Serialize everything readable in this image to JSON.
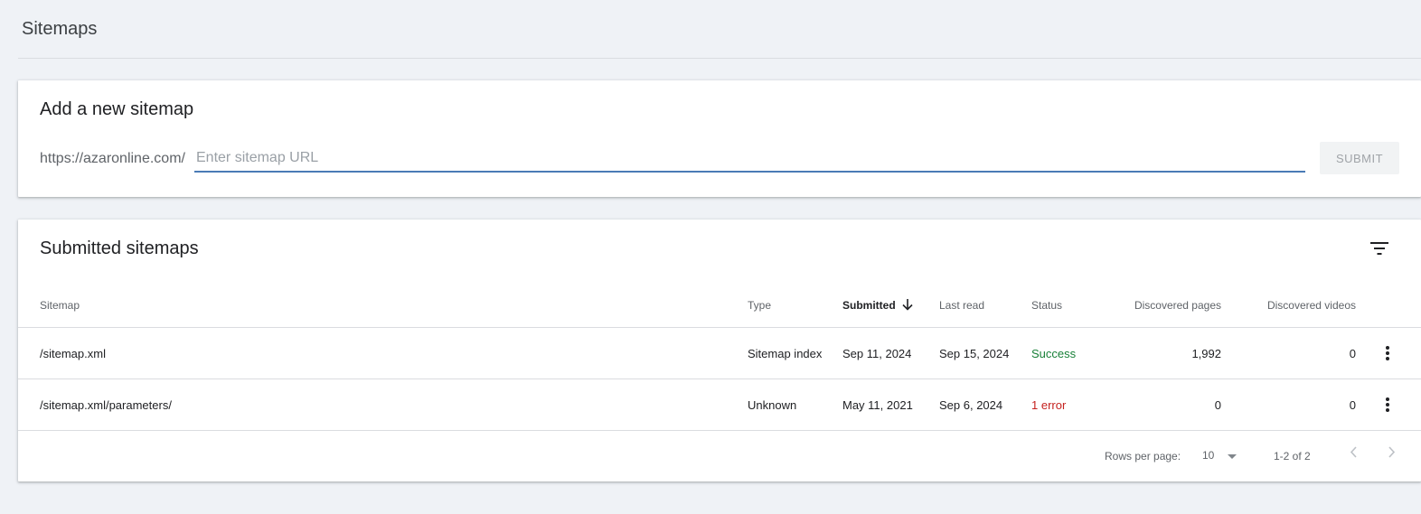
{
  "page": {
    "title": "Sitemaps"
  },
  "add_sitemap": {
    "title": "Add a new sitemap",
    "url_prefix": "https://azaronline.com/",
    "input_value": "",
    "input_placeholder": "Enter sitemap URL",
    "submit_label": "SUBMIT"
  },
  "submitted": {
    "title": "Submitted sitemaps",
    "filter_icon": "filter-icon",
    "columns": {
      "sitemap": "Sitemap",
      "type": "Type",
      "submitted": "Submitted",
      "last_read": "Last read",
      "status": "Status",
      "discovered_pages": "Discovered pages",
      "discovered_videos": "Discovered videos"
    },
    "sort": {
      "column": "submitted",
      "direction": "descending"
    },
    "rows": [
      {
        "sitemap": "/sitemap.xml",
        "type": "Sitemap index",
        "submitted": "Sep 11, 2024",
        "last_read": "Sep 15, 2024",
        "status": "Success",
        "discovered_pages": "1,992",
        "discovered_videos": "0"
      },
      {
        "sitemap": "/sitemap.xml/parameters/",
        "type": "Unknown",
        "submitted": "May 11, 2021",
        "last_read": "Sep 6, 2024",
        "status": "1 error",
        "discovered_pages": "0",
        "discovered_videos": "0"
      }
    ],
    "pagination": {
      "rows_per_page_label": "Rows per page:",
      "rows_per_page_value": "10",
      "range": "1-2 of 2"
    }
  },
  "colors": {
    "background": "#eff2f6",
    "input_underline": "#4a7bb6",
    "success": "#188038",
    "error": "#c5221f"
  }
}
